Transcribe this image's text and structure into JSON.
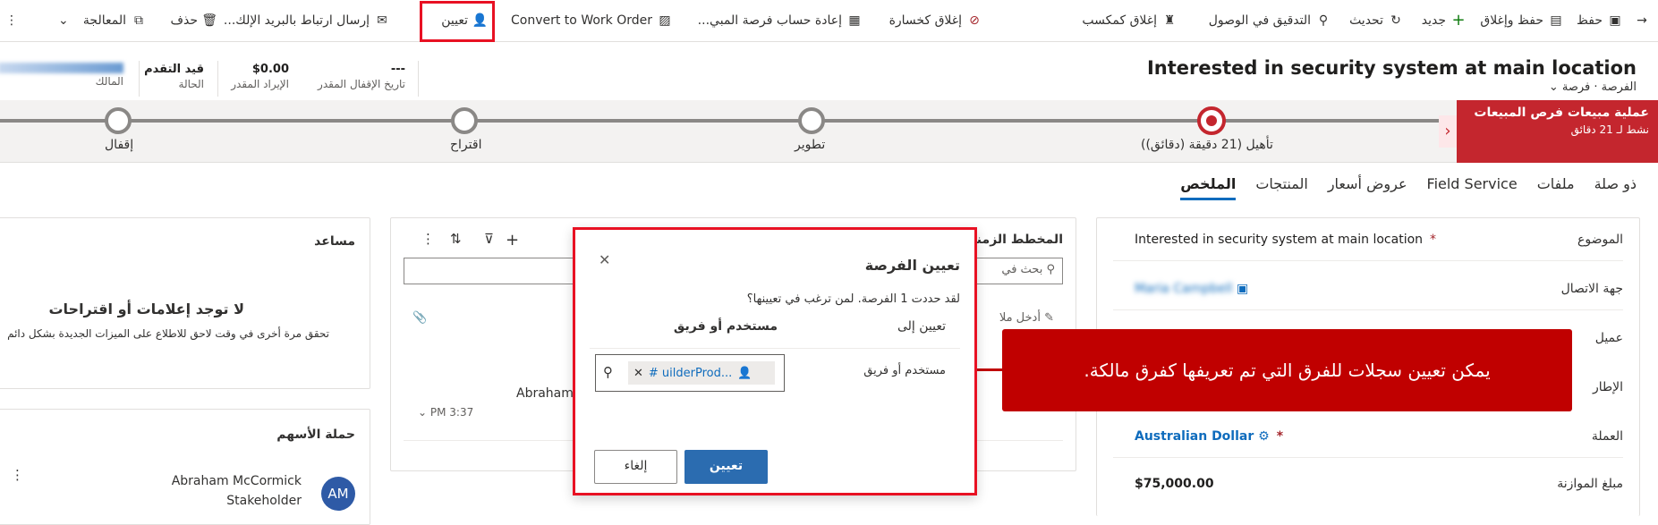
{
  "commands": {
    "save": "حفظ",
    "save_close": "حفظ وإغلاق",
    "new": "جديد",
    "refresh": "تحديث",
    "check_access": "التدقيق في الوصول",
    "close_won": "إغلاق كمكسب",
    "close_lost": "إغلاق كخسارة",
    "recalculate": "إعادة حساب فرصة المبي...",
    "convert": "Convert to Work Order",
    "assign": "تعيين",
    "email_link": "إرسال ارتباط بالبريد الإلك...",
    "delete": "حذف",
    "process": "المعالجة"
  },
  "record": {
    "title": "Interested in security system at main location",
    "breadcrumb": "الفرصة · فرصة",
    "close_date_value": "---",
    "close_date_label": "تاريخ الإقفال المقدر",
    "revenue_value": "$0.00",
    "revenue_label": "الإيراد المقدر",
    "status_value": "قيد التقدم",
    "status_label": "الحالة",
    "owner_label": "المالك"
  },
  "process": {
    "name": "عملية مبيعات فرص المبيعات",
    "active_for": "نشط لـ 21 دقائق",
    "stages": [
      "تأهيل (21 دقيقة (دقائق))",
      "تطوير",
      "اقتراح",
      "إقفال"
    ]
  },
  "tabs": [
    "الملخص",
    "المنتجات",
    "عروض أسعار",
    "Field Service",
    "ملفات",
    "ذو صلة"
  ],
  "summary": {
    "topic_label": "الموضوع",
    "topic_value": "Interested in security system at main location",
    "contact_label": "جهة الاتصال",
    "contact_value": "Maria Campbell",
    "account_label": "عميل",
    "purchase_label": "الإطار",
    "currency_label": "العملة",
    "currency_value": "Australian Dollar",
    "budget_label": "مبلغ الموازنة",
    "budget_value": "$75,000.00"
  },
  "timeline": {
    "title": "المخطط الزمني",
    "search_placeholder": "بحث في",
    "note_placeholder": "أدخل ملا",
    "entry_name": "Abraham",
    "entry_time": "PM 3:37"
  },
  "assistant": {
    "title": "مساعد",
    "empty_title": "لا توجد إعلامات أو اقتراحات",
    "empty_text": "تحقق مرة أخرى في وقت لاحق للاطلاع على الميزات الجديدة بشكل دائم"
  },
  "stakeholders": {
    "title": "حملة الأسهم",
    "name": "Abraham McCormick",
    "role": "Stakeholder",
    "initials": "AM"
  },
  "dialog": {
    "title": "تعيين الفرصة",
    "subtitle": "لقد حددت 1 الفرصة. لمن ترغب في تعيينها؟",
    "assign_to_label": "تعيين إلى",
    "assign_to_value": "مستخدم أو فريق",
    "field_label": "مستخدم أو فريق",
    "lookup_value": "# uilderProd...",
    "assign_button": "تعيين",
    "cancel_button": "إلغاء"
  },
  "callout": {
    "text": "يمكن تعيين سجلات للفرق التي تم تعريفها كفرق مالكة."
  }
}
